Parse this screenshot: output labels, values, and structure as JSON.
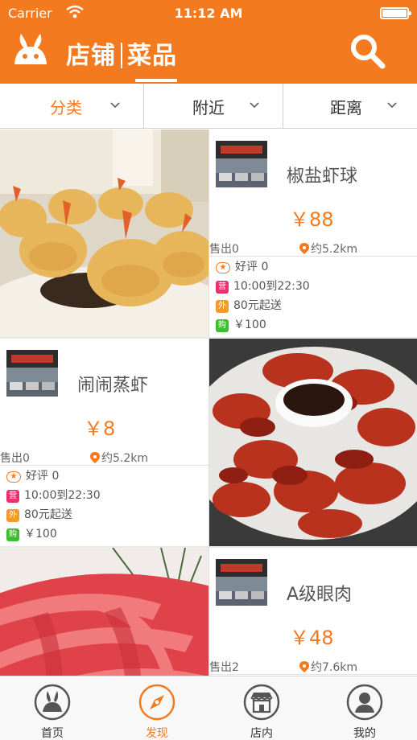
{
  "status_bar": {
    "carrier": "Carrier",
    "time": "11:12 AM"
  },
  "nav": {
    "title_left": "店铺",
    "title_right": "菜品"
  },
  "filters": [
    {
      "label": "分类",
      "active": true
    },
    {
      "label": "附近",
      "active": false
    },
    {
      "label": "距离",
      "active": false
    }
  ],
  "items": [
    {
      "name": "椒盐虾球",
      "price": "￥88",
      "sold": "售出0",
      "distance": "约5.2km",
      "rating": "好评 0",
      "hours": "10:00到22:30",
      "min_order": "80元起送",
      "purchase": "￥100"
    },
    {
      "name": "闹闹蒸虾",
      "price": "￥8",
      "sold": "售出0",
      "distance": "约5.2km",
      "rating": "好评 0",
      "hours": "10:00到22:30",
      "min_order": "80元起送",
      "purchase": "￥100"
    },
    {
      "name": "A级眼肉",
      "price": "￥48",
      "sold": "售出2",
      "distance": "约7.6km"
    }
  ],
  "badges": {
    "star": "★",
    "hours": "营",
    "min_order": "外",
    "purchase": "购"
  },
  "tabs": [
    {
      "label": "首页",
      "icon": "rabbit-icon"
    },
    {
      "label": "发现",
      "icon": "compass-icon",
      "active": true
    },
    {
      "label": "店内",
      "icon": "storefront-icon"
    },
    {
      "label": "我的",
      "icon": "user-icon"
    }
  ],
  "colors": {
    "accent": "#f47a20",
    "badge_red": "#e8316f",
    "badge_orange": "#f39a2b",
    "badge_green": "#3cbf2e"
  }
}
